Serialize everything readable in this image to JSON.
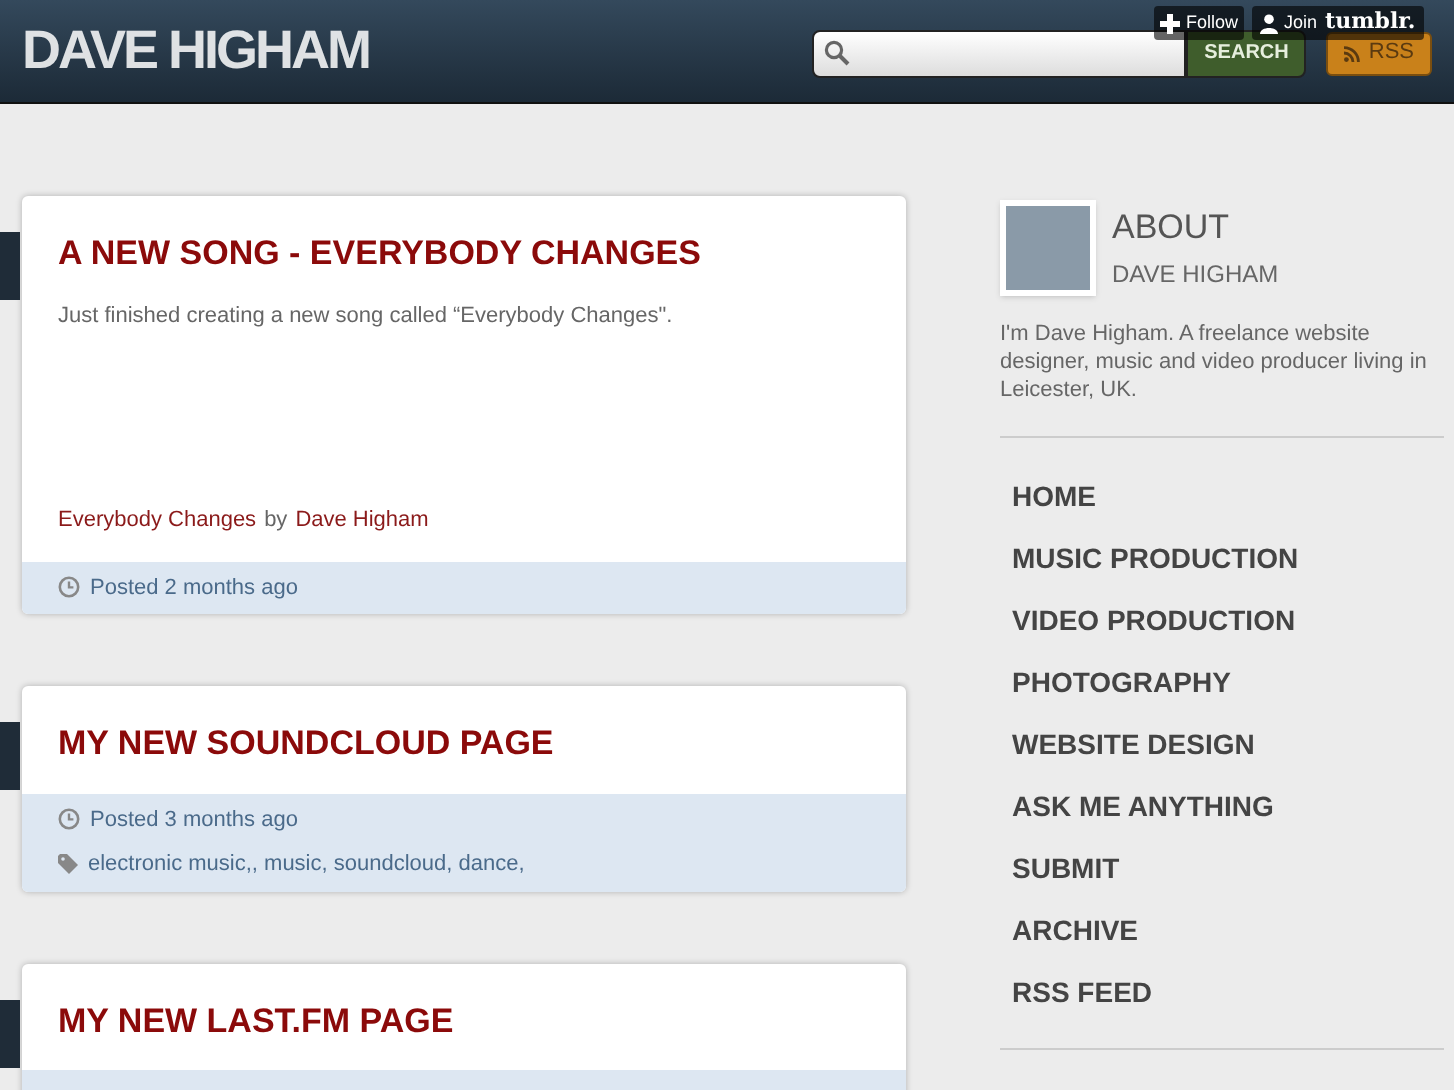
{
  "header": {
    "title": "DAVE HIGHAM",
    "search": {
      "button": "SEARCH"
    },
    "rss": "RSS",
    "follow": "Follow",
    "join": "Join",
    "tumblr": "tumblr."
  },
  "posts": [
    {
      "title": "A NEW SONG - EVERYBODY CHANGES",
      "body": "Just finished creating a new song called “Everybody Changes\".",
      "credit": {
        "track": "Everybody Changes",
        "by": "by",
        "artist": "Dave Higham"
      },
      "posted": "Posted 2 months ago"
    },
    {
      "title": "MY NEW SOUNDCLOUD PAGE",
      "posted": "Posted 3 months ago",
      "tags": "electronic music,, music, soundcloud, dance,"
    },
    {
      "title": "MY NEW LAST.FM PAGE"
    }
  ],
  "sidebar": {
    "about": "ABOUT",
    "name": "DAVE HIGHAM",
    "bio": "I'm Dave Higham. A freelance website designer, music and video producer living in Leicester, UK.",
    "nav": [
      "HOME",
      "MUSIC PRODUCTION",
      "VIDEO PRODUCTION",
      "PHOTOGRAPHY",
      "WEBSITE DESIGN",
      "ASK ME ANYTHING",
      "SUBMIT",
      "ARCHIVE",
      "RSS FEED"
    ]
  }
}
